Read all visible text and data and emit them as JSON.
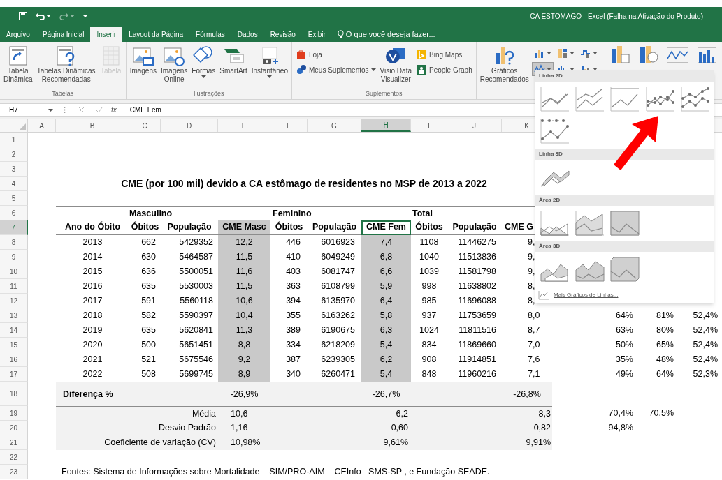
{
  "window": {
    "title": "CA ESTOMAGO - Excel (Falha na Ativação do Produto)"
  },
  "tabs": [
    {
      "label": "Arquivo",
      "selected": false
    },
    {
      "label": "Página Inicial",
      "selected": false
    },
    {
      "label": "Inserir",
      "selected": true
    },
    {
      "label": "Layout da Página",
      "selected": false
    },
    {
      "label": "Fórmulas",
      "selected": false
    },
    {
      "label": "Dados",
      "selected": false
    },
    {
      "label": "Revisão",
      "selected": false
    },
    {
      "label": "Exibir",
      "selected": false
    }
  ],
  "tell_me": {
    "placeholder": "O que você deseja fazer..."
  },
  "ribbon": {
    "groups": [
      {
        "label": "Tabelas",
        "items": [
          {
            "kind": "large",
            "lines": [
              "Tabela",
              "Dinâmica"
            ],
            "disabled": false,
            "has_menu": false
          },
          {
            "kind": "large",
            "lines": [
              "Tabelas Dinâmicas",
              "Recomendadas"
            ],
            "disabled": false,
            "has_menu": false
          },
          {
            "kind": "large",
            "lines": [
              "Tabela"
            ],
            "disabled": true,
            "has_menu": false
          }
        ]
      },
      {
        "label": "Ilustrações",
        "items": [
          {
            "kind": "large",
            "lines": [
              "Imagens"
            ],
            "disabled": false,
            "has_menu": false
          },
          {
            "kind": "large",
            "lines": [
              "Imagens",
              "Online"
            ],
            "disabled": false,
            "has_menu": false
          },
          {
            "kind": "large",
            "lines": [
              "Formas"
            ],
            "disabled": false,
            "has_menu": true
          },
          {
            "kind": "large",
            "lines": [
              "SmartArt"
            ],
            "disabled": false,
            "has_menu": false
          },
          {
            "kind": "large",
            "lines": [
              "Instantâneo"
            ],
            "disabled": false,
            "has_menu": true
          }
        ]
      },
      {
        "label": "Suplementos",
        "items": [
          {
            "kind": "stack",
            "items": [
              {
                "label": "Loja",
                "has_menu": false
              },
              {
                "label": "Meus Suplementos",
                "has_menu": true
              }
            ]
          },
          {
            "kind": "large",
            "lines": [
              "Visio Data",
              "Visualizer"
            ],
            "disabled": false,
            "has_menu": false
          },
          {
            "kind": "stack",
            "items": [
              {
                "label": "Bing Maps",
                "has_menu": false
              },
              {
                "label": "People Graph",
                "has_menu": false
              }
            ]
          }
        ]
      },
      {
        "items": [
          {
            "kind": "large",
            "lines": [
              "Gráficos",
              "Recomendados"
            ],
            "disabled": false,
            "has_menu": false
          },
          {
            "kind": "chart_grid",
            "buttons": [
              {
                "selected": false
              },
              {
                "selected": false
              },
              {
                "selected": false
              },
              {
                "selected": true
              },
              {
                "selected": false
              },
              {
                "selected": false
              }
            ]
          }
        ]
      }
    ]
  },
  "formula_bar": {
    "name_box": "H7",
    "function_button": "fx",
    "content": "CME Fem"
  },
  "columns": [
    {
      "letter": "A",
      "selected": false
    },
    {
      "letter": "B",
      "selected": false
    },
    {
      "letter": "C",
      "selected": false
    },
    {
      "letter": "D",
      "selected": false
    },
    {
      "letter": "E",
      "selected": false
    },
    {
      "letter": "F",
      "selected": false
    },
    {
      "letter": "G",
      "selected": false
    },
    {
      "letter": "H",
      "selected": true
    },
    {
      "letter": "I",
      "selected": false
    },
    {
      "letter": "J",
      "selected": false
    },
    {
      "letter": "K",
      "selected": false
    }
  ],
  "row_numbers": [
    {
      "label": "1",
      "selected": false
    },
    {
      "label": "2",
      "selected": false
    },
    {
      "label": "3",
      "selected": false
    },
    {
      "label": "4",
      "selected": false
    },
    {
      "label": "5",
      "selected": false
    },
    {
      "label": "6",
      "selected": false
    },
    {
      "label": "7",
      "selected": true
    },
    {
      "label": "8",
      "selected": false
    },
    {
      "label": "9",
      "selected": false
    },
    {
      "label": "10",
      "selected": false
    },
    {
      "label": "11",
      "selected": false
    },
    {
      "label": "12",
      "selected": false
    },
    {
      "label": "13",
      "selected": false
    },
    {
      "label": "14",
      "selected": false
    },
    {
      "label": "15",
      "selected": false
    },
    {
      "label": "16",
      "selected": false
    },
    {
      "label": "17",
      "selected": false
    },
    {
      "label": "18",
      "selected": false
    },
    {
      "label": "19",
      "selected": false
    },
    {
      "label": "20",
      "selected": false
    },
    {
      "label": "21",
      "selected": false
    },
    {
      "label": "22",
      "selected": false
    },
    {
      "label": "23",
      "selected": false
    }
  ],
  "report": {
    "title": "CME (por 100 mil) devido a CA estômago de residentes no MSP de 2013 a 2022",
    "groups": [
      "Masculino",
      "Feminino",
      "Total"
    ],
    "headings": [
      {
        "label": "Ano do Óbito",
        "selected": false
      },
      {
        "label": "Óbitos",
        "selected": false
      },
      {
        "label": "População",
        "selected": false
      },
      {
        "label": "CME Masc",
        "selected": false
      },
      {
        "label": "Óbitos",
        "selected": false
      },
      {
        "label": "População",
        "selected": false
      },
      {
        "label": "CME Fem",
        "selected": true
      },
      {
        "label": "Óbitos",
        "selected": false
      },
      {
        "label": "População",
        "selected": false
      },
      {
        "label": "CME G",
        "selected": false
      }
    ],
    "rows": [
      {
        "values": [
          "2013",
          "662",
          "5429352",
          "12,2",
          "446",
          "6016923",
          "7,4",
          "1108",
          "11446275",
          "9,"
        ]
      },
      {
        "values": [
          "2014",
          "630",
          "5464587",
          "11,5",
          "410",
          "6049249",
          "6,8",
          "1040",
          "11513836",
          "9,"
        ]
      },
      {
        "values": [
          "2015",
          "636",
          "5500051",
          "11,6",
          "403",
          "6081747",
          "6,6",
          "1039",
          "11581798",
          "9,"
        ]
      },
      {
        "values": [
          "2016",
          "635",
          "5530003",
          "11,5",
          "363",
          "6108799",
          "5,9",
          "998",
          "11638802",
          "8,"
        ]
      },
      {
        "values": [
          "2017",
          "591",
          "5560118",
          "10,6",
          "394",
          "6135970",
          "6,4",
          "985",
          "11696088",
          "8,"
        ]
      },
      {
        "values": [
          "2018",
          "582",
          "5590397",
          "10,4",
          "355",
          "6163262",
          "5,8",
          "937",
          "11753659",
          "8,0"
        ],
        "extra": [
          "64%",
          "81%",
          "52,4%"
        ]
      },
      {
        "values": [
          "2019",
          "635",
          "5620841",
          "11,3",
          "389",
          "6190675",
          "6,3",
          "1024",
          "11811516",
          "8,7"
        ],
        "extra": [
          "63%",
          "80%",
          "52,4%"
        ]
      },
      {
        "values": [
          "2020",
          "500",
          "5651451",
          "8,8",
          "334",
          "6218209",
          "5,4",
          "834",
          "11869660",
          "7,0"
        ],
        "extra": [
          "50%",
          "65%",
          "52,4%"
        ]
      },
      {
        "values": [
          "2021",
          "521",
          "5675546",
          "9,2",
          "387",
          "6239305",
          "6,2",
          "908",
          "11914851",
          "7,6"
        ],
        "extra": [
          "35%",
          "48%",
          "52,4%"
        ]
      },
      {
        "values": [
          "2022",
          "508",
          "5699745",
          "8,9",
          "340",
          "6260471",
          "5,4",
          "848",
          "11960216",
          "7,1"
        ],
        "extra": [
          "49%",
          "64%",
          "52,3%"
        ]
      }
    ],
    "difference": {
      "label": "Diferença %",
      "values": [
        "-26,9%",
        "-26,7%",
        "-26,8%"
      ]
    },
    "stats": [
      {
        "label": "Média",
        "values": [
          "10,6",
          "6,2",
          "8,3"
        ],
        "extra": [
          "70,4%",
          "70,5%"
        ]
      },
      {
        "label": "Desvio Padrão",
        "values": [
          "1,16",
          "0,60",
          "0,82"
        ],
        "extra": [
          "94,8%"
        ]
      },
      {
        "label": "Coeficiente de variação (CV)",
        "values": [
          "10,98%",
          "9,61%",
          "9,91%"
        ]
      }
    ],
    "source": "Fontes: Sistema de Informações sobre Mortalidade – SIM/PRO-AIM – CEInfo –SMS-SP , e Fundação SEADE."
  },
  "gallery": {
    "sections": [
      {
        "title": "Linha 2D",
        "items": [
          {
            "kind": "line"
          },
          {
            "kind": "stacked_line"
          },
          {
            "kind": "percent_line"
          },
          {
            "kind": "line_markers"
          },
          {
            "kind": "stacked_line_markers"
          },
          {
            "kind": "percent_line_markers"
          }
        ]
      },
      {
        "title": "Linha 3D",
        "items": [
          {
            "kind": "line_3d"
          }
        ]
      },
      {
        "title": "Área 2D",
        "items": [
          {
            "kind": "area"
          },
          {
            "kind": "stacked_area"
          },
          {
            "kind": "percent_area"
          }
        ]
      },
      {
        "title": "Área 3D",
        "items": [
          {
            "kind": "area_3d"
          },
          {
            "kind": "stacked_area_3d"
          },
          {
            "kind": "percent_area_3d"
          }
        ]
      }
    ],
    "more_link": "Mais Gráficos de Linhas..."
  }
}
